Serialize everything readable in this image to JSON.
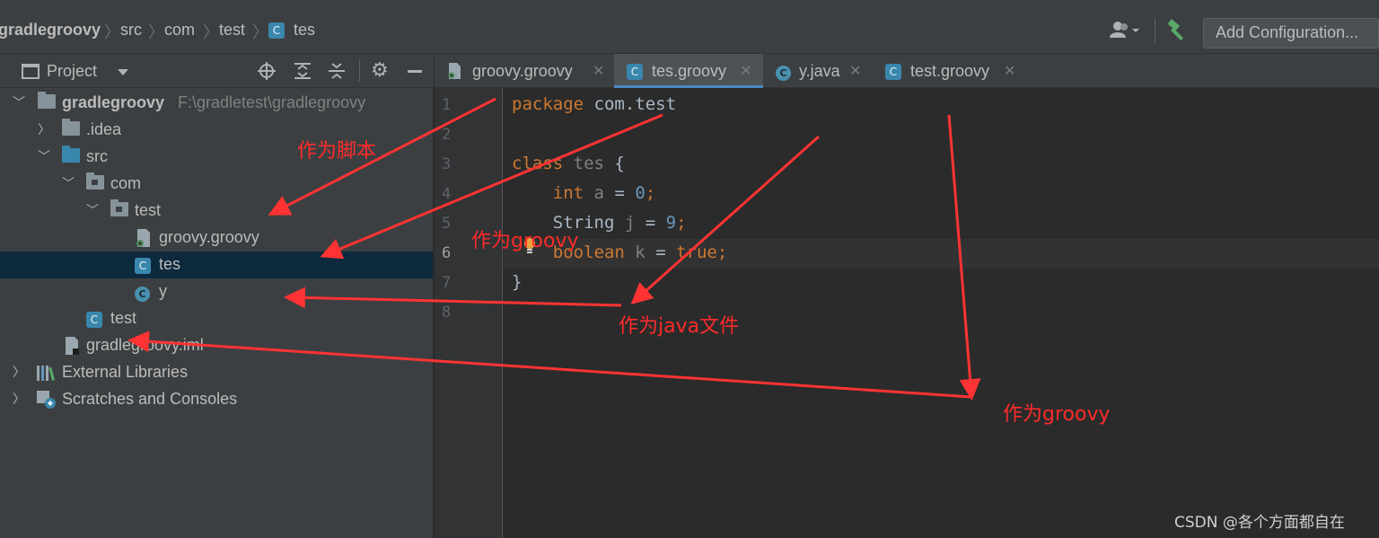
{
  "navbar": {
    "crumbs": [
      "gradlegroovy",
      "src",
      "com",
      "test",
      "tes"
    ],
    "add_configuration": "Add Configuration..."
  },
  "project_panel": {
    "title": "Project",
    "tree": [
      {
        "label": "gradlegroovy",
        "path": "F:\\gradletest\\gradlegroovy",
        "icon": "module-folder-icon"
      },
      {
        "label": ".idea",
        "icon": "folder-icon"
      },
      {
        "label": "src",
        "icon": "source-folder-icon"
      },
      {
        "label": "com",
        "icon": "package-icon"
      },
      {
        "label": "test",
        "icon": "package-icon"
      },
      {
        "label": "groovy.groovy",
        "icon": "groovy-script-icon"
      },
      {
        "label": "tes",
        "icon": "groovy-class-icon"
      },
      {
        "label": "y",
        "icon": "java-class-icon"
      },
      {
        "label": "test",
        "icon": "groovy-class-icon"
      },
      {
        "label": "gradlegroovy.iml",
        "icon": "iml-file-icon"
      },
      {
        "label": "External Libraries",
        "icon": "libraries-icon"
      },
      {
        "label": "Scratches and Consoles",
        "icon": "scratches-icon"
      }
    ]
  },
  "tabs": [
    {
      "label": "groovy.groovy",
      "icon": "groovy-script-icon"
    },
    {
      "label": "tes.groovy",
      "icon": "groovy-class-icon",
      "active": true
    },
    {
      "label": "y.java",
      "icon": "java-class-icon"
    },
    {
      "label": "test.groovy",
      "icon": "groovy-class-icon"
    }
  ],
  "editor": {
    "line_numbers": [
      "1",
      "2",
      "3",
      "4",
      "5",
      "6",
      "7",
      "8"
    ],
    "current_line": 6
  },
  "annotations": {
    "script": "作为脚本",
    "groovy1": "作为groovy",
    "java": "作为java文件",
    "groovy2": "作为groovy",
    "arrow_color": "#ff3333"
  },
  "watermark": "CSDN @各个方面都自在"
}
